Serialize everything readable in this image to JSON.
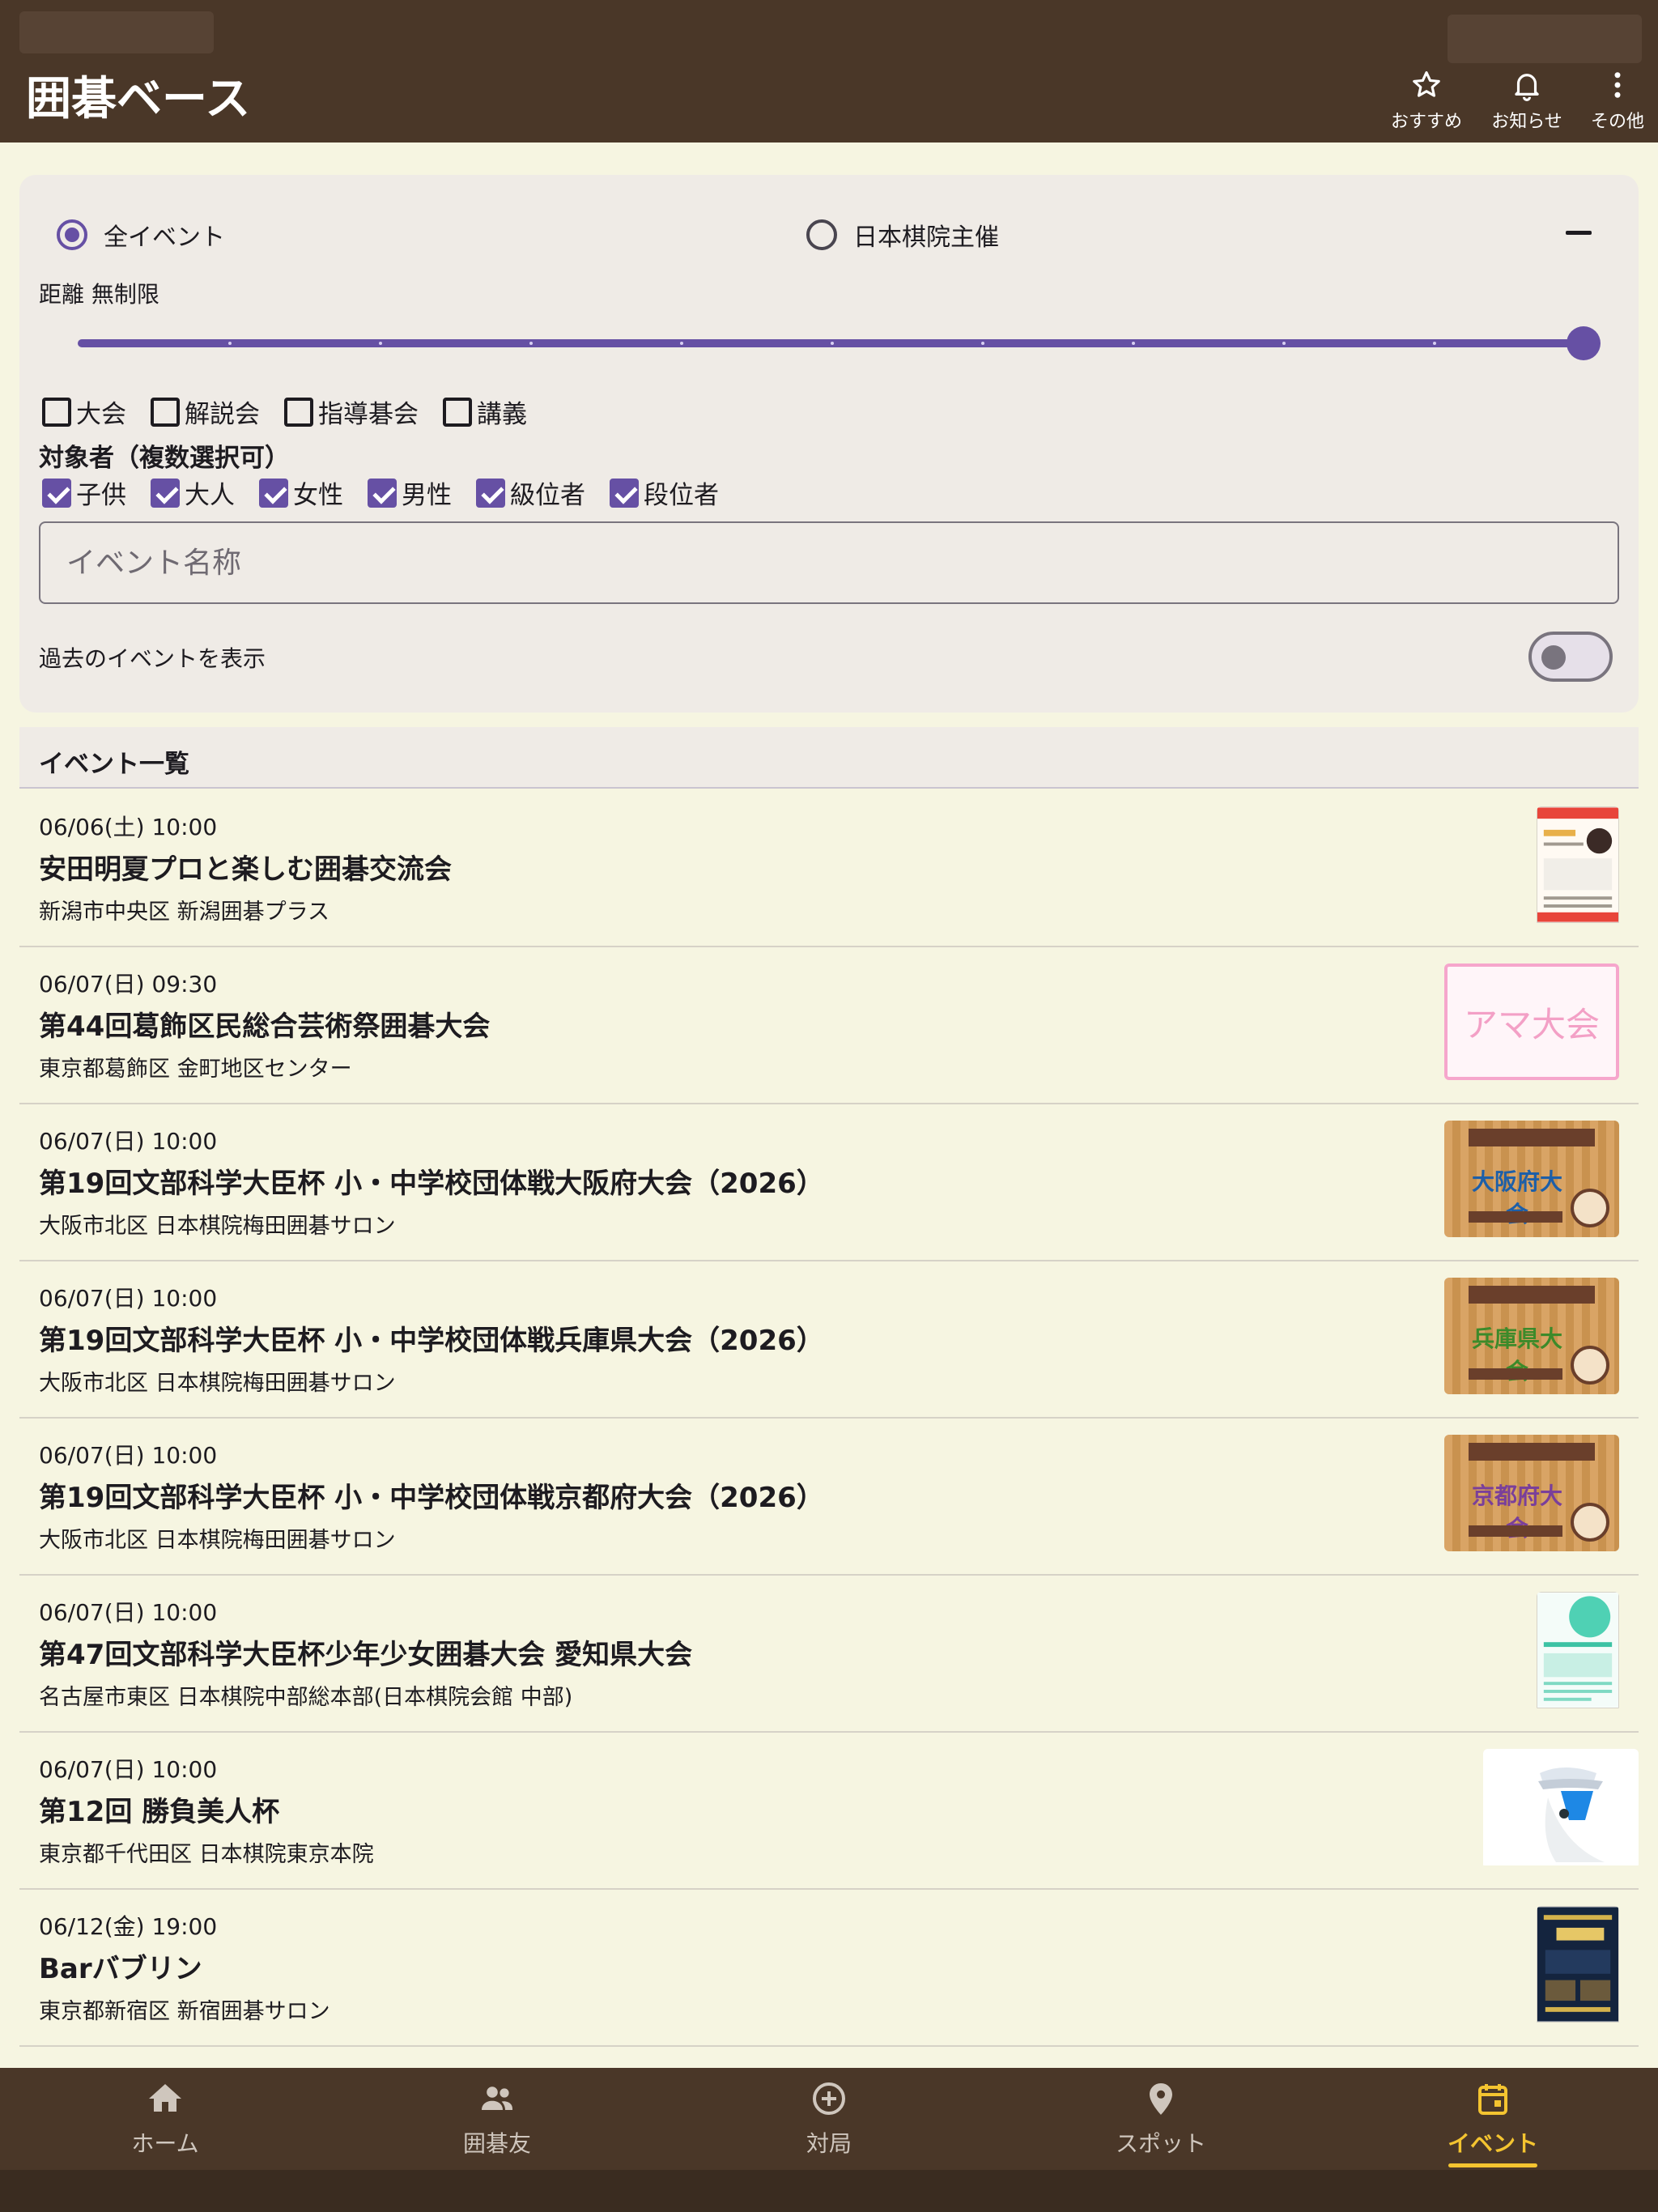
{
  "header": {
    "title": "囲碁ベース",
    "actions": [
      {
        "label": "おすすめ",
        "icon": "star-icon"
      },
      {
        "label": "お知らせ",
        "icon": "bell-icon"
      },
      {
        "label": "その他",
        "icon": "more-vert-icon"
      }
    ]
  },
  "filter": {
    "radio_all": "全イベント",
    "radio_nihon_kiin": "日本棋院主催",
    "selected_radio": "全イベント",
    "distance_label": "距離 無制限",
    "distance_level": 1.0,
    "categories": [
      {
        "label": "大会",
        "checked": false
      },
      {
        "label": "解説会",
        "checked": false
      },
      {
        "label": "指導碁会",
        "checked": false
      },
      {
        "label": "講義",
        "checked": false
      }
    ],
    "target_heading": "対象者（複数選択可）",
    "targets": [
      {
        "label": "子供",
        "checked": true
      },
      {
        "label": "大人",
        "checked": true
      },
      {
        "label": "女性",
        "checked": true
      },
      {
        "label": "男性",
        "checked": true
      },
      {
        "label": "級位者",
        "checked": true
      },
      {
        "label": "段位者",
        "checked": true
      }
    ],
    "name_placeholder": "イベント名称",
    "name_value": "",
    "past_label": "過去のイベントを表示",
    "past_enabled": false
  },
  "list": {
    "heading": "イベント一覧",
    "events": [
      {
        "date": "06/06(土) 10:00",
        "title": "安田明夏プロと楽しむ囲碁交流会",
        "place": "新潟市中央区 新潟囲碁プラス"
      },
      {
        "date": "06/07(日) 09:30",
        "title": "第44回葛飾区民総合芸術祭囲碁大会",
        "place": "東京都葛飾区 金町地区センター",
        "poster_text": "アマ大会"
      },
      {
        "date": "06/07(日) 10:00",
        "title": "第19回文部科学大臣杯 小・中学校団体戦大阪府大会（2026）",
        "place": "大阪市北区 日本棋院梅田囲碁サロン",
        "poster_text": "大阪府大会"
      },
      {
        "date": "06/07(日) 10:00",
        "title": "第19回文部科学大臣杯 小・中学校団体戦兵庫県大会（2026）",
        "place": "大阪市北区 日本棋院梅田囲碁サロン",
        "poster_text": "兵庫県大会"
      },
      {
        "date": "06/07(日) 10:00",
        "title": "第19回文部科学大臣杯 小・中学校団体戦京都府大会（2026）",
        "place": "大阪市北区 日本棋院梅田囲碁サロン",
        "poster_text": "京都府大会"
      },
      {
        "date": "06/07(日) 10:00",
        "title": "第47回文部科学大臣杯少年少女囲碁大会 愛知県大会",
        "place": "名古屋市東区 日本棋院中部総本部(日本棋院会館 中部)"
      },
      {
        "date": "06/07(日) 10:00",
        "title": "第12回 勝負美人杯",
        "place": "東京都千代田区 日本棋院東京本院"
      },
      {
        "date": "06/12(金) 19:00",
        "title": "Barバブリン",
        "place": "東京都新宿区 新宿囲碁サロン"
      }
    ]
  },
  "bottom_nav": {
    "items": [
      {
        "label": "ホーム",
        "icon": "home-icon"
      },
      {
        "label": "囲碁友",
        "icon": "people-icon"
      },
      {
        "label": "対局",
        "icon": "add-circle-icon"
      },
      {
        "label": "スポット",
        "icon": "location-pin-icon"
      },
      {
        "label": "イベント",
        "icon": "calendar-icon"
      }
    ],
    "active": "イベント"
  },
  "colors": {
    "header_bg": "#4a3728",
    "accent": "#6650a4",
    "active_nav": "#f4c430",
    "page_bg": "#f6f5e1"
  }
}
